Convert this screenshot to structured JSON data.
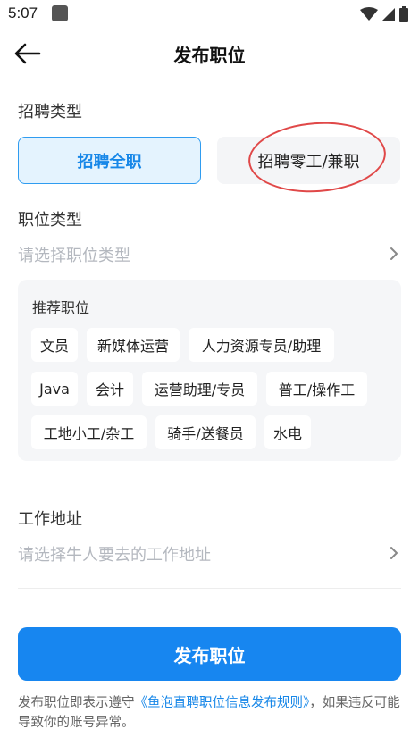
{
  "status_bar": {
    "time": "5:07",
    "icons": [
      "app-notification-icon",
      "wifi-icon",
      "signal-icon",
      "battery-icon"
    ]
  },
  "header": {
    "title": "发布职位",
    "back_icon": "arrow-left-icon"
  },
  "recruit_type": {
    "label": "招聘类型",
    "options": [
      {
        "label": "招聘全职",
        "selected": true
      },
      {
        "label": "招聘零工/兼职",
        "selected": false
      }
    ]
  },
  "job_type": {
    "label": "职位类型",
    "placeholder": "请选择职位类型"
  },
  "recommend": {
    "title": "推荐职位",
    "tags": [
      "文员",
      "新媒体运营",
      "人力资源专员/助理",
      "Java",
      "会计",
      "运营助理/专员",
      "普工/操作工",
      "工地小工/杂工",
      "骑手/送餐员",
      "水电"
    ]
  },
  "work_address": {
    "label": "工作地址",
    "placeholder": "请选择牛人要去的工作地址"
  },
  "submit": {
    "label": "发布职位"
  },
  "agreement": {
    "prefix": "发布职位即表示遵守",
    "link": "《鱼泡直聘职位信息发布规则》",
    "suffix": "，如果违反可能导致你的账号异常。"
  },
  "colors": {
    "accent": "#1786f0",
    "selected_bg": "#e4f3fe",
    "annotation": "#e04848",
    "placeholder": "#b4b8bf"
  }
}
